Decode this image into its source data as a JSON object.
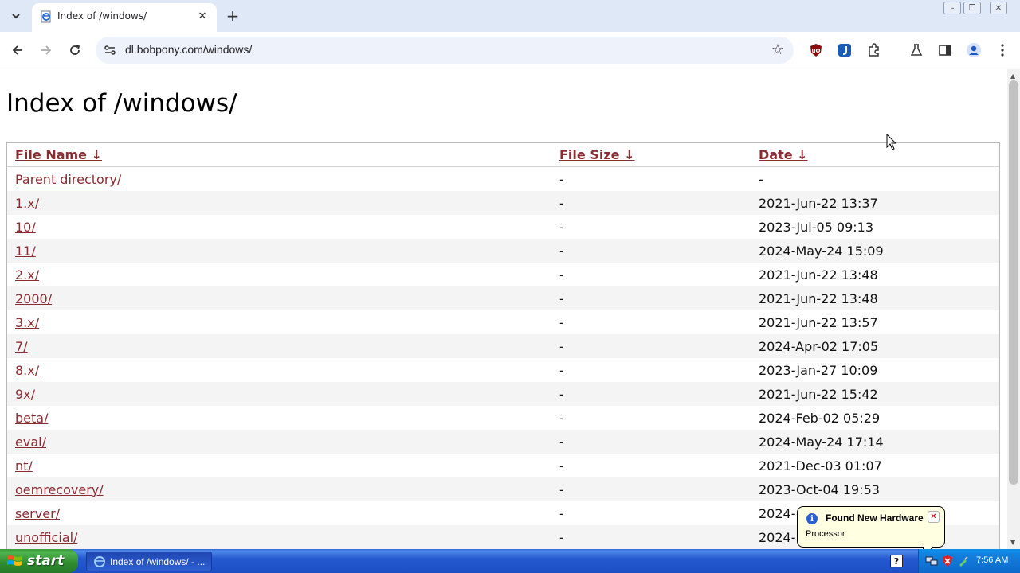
{
  "browser": {
    "tab_title": "Index of /windows/",
    "url": "dl.bobpony.com/windows/"
  },
  "page": {
    "title": "Index of /windows/",
    "columns": {
      "name": "File Name  ↓",
      "size": "File Size  ↓",
      "date": "Date  ↓"
    },
    "rows": [
      {
        "name": "Parent directory/",
        "size": "-",
        "date": "-"
      },
      {
        "name": "1.x/",
        "size": "-",
        "date": "2021-Jun-22 13:37"
      },
      {
        "name": "10/",
        "size": "-",
        "date": "2023-Jul-05 09:13"
      },
      {
        "name": "11/",
        "size": "-",
        "date": "2024-May-24 15:09"
      },
      {
        "name": "2.x/",
        "size": "-",
        "date": "2021-Jun-22 13:48"
      },
      {
        "name": "2000/",
        "size": "-",
        "date": "2021-Jun-22 13:48"
      },
      {
        "name": "3.x/",
        "size": "-",
        "date": "2021-Jun-22 13:57"
      },
      {
        "name": "7/",
        "size": "-",
        "date": "2024-Apr-02 17:05"
      },
      {
        "name": "8.x/",
        "size": "-",
        "date": "2023-Jan-27 10:09"
      },
      {
        "name": "9x/",
        "size": "-",
        "date": "2021-Jun-22 15:42"
      },
      {
        "name": "beta/",
        "size": "-",
        "date": "2024-Feb-02 05:29"
      },
      {
        "name": "eval/",
        "size": "-",
        "date": "2024-May-24 17:14"
      },
      {
        "name": "nt/",
        "size": "-",
        "date": "2021-Dec-03 01:07"
      },
      {
        "name": "oemrecovery/",
        "size": "-",
        "date": "2023-Oct-04 19:53"
      },
      {
        "name": "server/",
        "size": "-",
        "date": "2024-"
      },
      {
        "name": "unofficial/",
        "size": "-",
        "date": "2024-"
      }
    ]
  },
  "balloon": {
    "title": "Found New Hardware",
    "text": "Processor"
  },
  "taskbar": {
    "start_label": "start",
    "task_label": "Index of /windows/ - ...",
    "clock": "7:56 AM"
  },
  "icons": {
    "tab_favicon": "ie-page-icon",
    "tray": [
      "network-icon",
      "antivirus-icon",
      "safely-remove-icon"
    ]
  },
  "colors": {
    "link": "#8a2d33",
    "tab_strip": "#dfe8f7",
    "taskbar": "#2459d0",
    "start": "#3c9a3c",
    "balloon": "#ffffe1"
  }
}
